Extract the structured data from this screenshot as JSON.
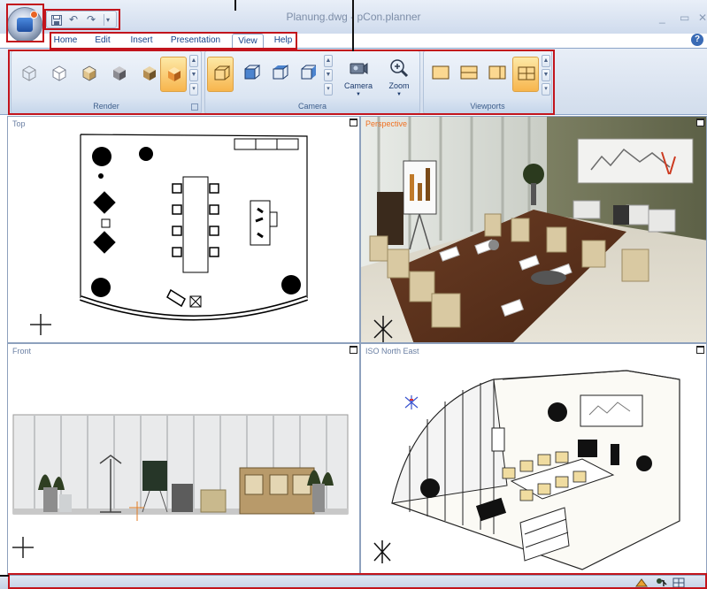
{
  "window": {
    "title": "Planung.dwg - pCon.planner",
    "controls": [
      "_",
      "▭",
      "✕"
    ],
    "help": "?"
  },
  "quick_access": {
    "items": [
      "save-icon",
      "undo-icon",
      "redo-icon"
    ],
    "more": "▾"
  },
  "tabs": [
    {
      "label": "Home",
      "active": false
    },
    {
      "label": "Edit",
      "active": false
    },
    {
      "label": "Insert",
      "active": false
    },
    {
      "label": "Presentation",
      "active": false
    },
    {
      "label": "View",
      "active": true
    },
    {
      "label": "Help",
      "active": false
    }
  ],
  "ribbon": {
    "groups": [
      {
        "label": "Render",
        "buttons": [
          "wireframe-icon",
          "hidden-line-icon",
          "shaded-icon",
          "shaded-edges-icon",
          "realistic-icon",
          "render-active-icon"
        ]
      },
      {
        "label": "Camera",
        "buttons": [
          "perspective-icon",
          "front-view-icon",
          "top-view-icon",
          "iso-view-icon"
        ],
        "camera_label": "Camera",
        "zoom_label": "Zoom"
      },
      {
        "label": "Viewports",
        "buttons": [
          "single-viewport-icon",
          "two-horizontal-viewports-icon",
          "two-vertical-viewports-icon",
          "four-viewports-icon"
        ]
      }
    ]
  },
  "viewports": [
    {
      "label": "Top",
      "label_color": "#6a7fa3"
    },
    {
      "label": "Perspective",
      "label_color": "#f07020"
    },
    {
      "label": "Front",
      "label_color": "#6a7fa3"
    },
    {
      "label": "ISO North East",
      "label_color": "#6a7fa3"
    }
  ],
  "status_bar": {
    "icons": [
      "render-status-icon",
      "pointer-status-icon",
      "layout-status-icon"
    ]
  },
  "colors": {
    "accent": "#f7b54d",
    "callout": "#c2141c",
    "ribbon": "#d2ddec"
  }
}
